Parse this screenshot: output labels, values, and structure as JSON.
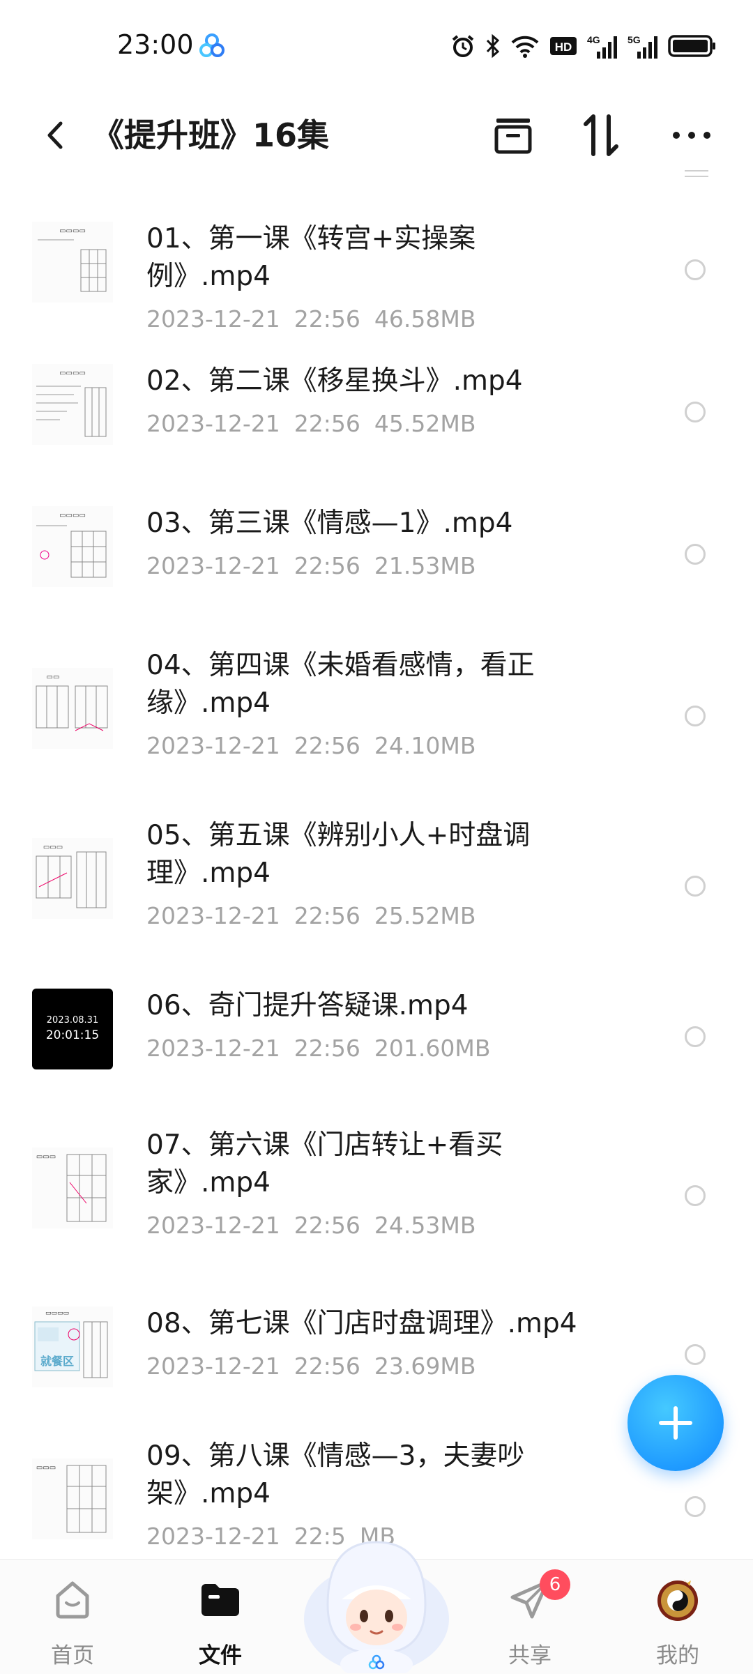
{
  "status_bar": {
    "time": "23:00",
    "icons": [
      "app-cloud-icon",
      "alarm-icon",
      "bluetooth-icon",
      "wifi-icon",
      "hd-icon",
      "signal-4g-icon",
      "signal-5g-icon",
      "battery-icon"
    ],
    "hd_label": "HD",
    "net1": "4G",
    "net2": "5G"
  },
  "header": {
    "title": "《提升班》16集",
    "icons": [
      "back-icon",
      "select-all-icon",
      "sort-icon",
      "more-icon"
    ]
  },
  "files": [
    {
      "name": "01、第一课《转宫+实操案例》.mp4",
      "date": "2023-12-21",
      "time": "22:56",
      "size": "46.58MB"
    },
    {
      "name": "02、第二课《移星换斗》.mp4",
      "date": "2023-12-21",
      "time": "22:56",
      "size": "45.52MB"
    },
    {
      "name": "03、第三课《情感—1》.mp4",
      "date": "2023-12-21",
      "time": "22:56",
      "size": "21.53MB"
    },
    {
      "name": "04、第四课《未婚看感情，看正缘》.mp4",
      "date": "2023-12-21",
      "time": "22:56",
      "size": "24.10MB"
    },
    {
      "name": "05、第五课《辨别小人+时盘调理》.mp4",
      "date": "2023-12-21",
      "time": "22:56",
      "size": "25.52MB"
    },
    {
      "name": "06、奇门提升答疑课.mp4",
      "date": "2023-12-21",
      "time": "22:56",
      "size": "201.60MB",
      "thumb_date": "2023.08.31",
      "thumb_time": "20:01:15"
    },
    {
      "name": "07、第六课《门店转让+看买家》.mp4",
      "date": "2023-12-21",
      "time": "22:56",
      "size": "24.53MB"
    },
    {
      "name": "08、第七课《门店时盘调理》.mp4",
      "date": "2023-12-21",
      "time": "22:56",
      "size": "23.69MB",
      "thumb_label": "就餐区"
    },
    {
      "name": "09、第八课《情感—3，夫妻吵架》.mp4",
      "date": "2023-12-21",
      "time": "22:5",
      "size": "MB"
    }
  ],
  "fab": {
    "icon": "plus-icon"
  },
  "bottom_nav": {
    "items": [
      {
        "label": "首页",
        "icon": "home-icon"
      },
      {
        "label": "文件",
        "icon": "folder-icon"
      },
      {
        "label": "共享",
        "icon": "send-icon",
        "badge": "6"
      },
      {
        "label": "我的",
        "icon": "avatar-icon"
      }
    ],
    "mascot": "assistant-mascot"
  },
  "colors": {
    "accent": "#1f9bff",
    "badge": "#ff4d5e",
    "meta_text": "#a3a3a3"
  }
}
